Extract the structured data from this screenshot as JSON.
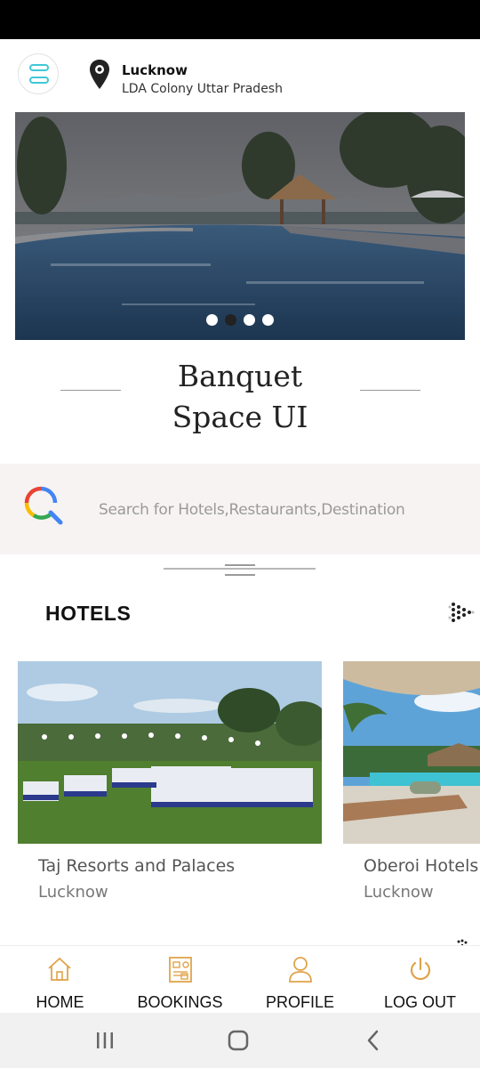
{
  "location": {
    "city": "Lucknow",
    "area": "LDA Colony Uttar Pradesh"
  },
  "carousel": {
    "slide_count": 4,
    "active_index": 1
  },
  "page_title": {
    "line1": "Banquet",
    "line2": "Space UI"
  },
  "search": {
    "placeholder": "Search for Hotels,Restaurants,Destination"
  },
  "hotels": {
    "section_title": "HOTELS",
    "items": [
      {
        "name": "Taj Resorts and Palaces",
        "city": "Lucknow"
      },
      {
        "name": "Oberoi Hotels &",
        "city": "Lucknow"
      }
    ]
  },
  "bottom_nav": {
    "items": [
      {
        "label": "HOME",
        "icon": "home-icon"
      },
      {
        "label": "BOOKINGS",
        "icon": "bookings-icon"
      },
      {
        "label": "PROFILE",
        "icon": "profile-icon"
      },
      {
        "label": "LOG OUT",
        "icon": "power-icon"
      }
    ]
  },
  "colors": {
    "accent_icon": "#e0a44a",
    "menu_accent": "#3fc8d6",
    "search_bg": "#f7f3f3"
  }
}
